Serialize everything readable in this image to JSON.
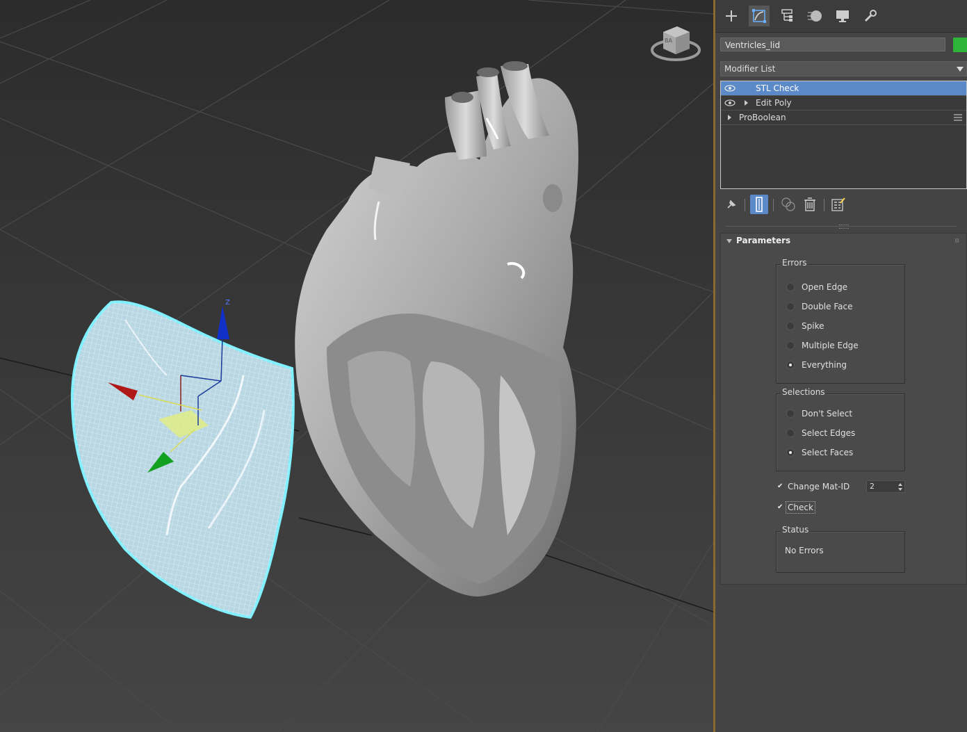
{
  "viewport": {
    "viewcube_label": "BA",
    "gizmo_axis_label": "Z"
  },
  "command_panel": {
    "tabs": [
      {
        "name": "create-tab",
        "icon": "plus-icon"
      },
      {
        "name": "modify-tab",
        "icon": "modify-icon"
      },
      {
        "name": "hierarchy-tab",
        "icon": "hierarchy-icon"
      },
      {
        "name": "motion-tab",
        "icon": "motion-icon"
      },
      {
        "name": "display-tab",
        "icon": "display-icon"
      },
      {
        "name": "utilities-tab",
        "icon": "wrench-icon"
      }
    ],
    "object_name": "Ventricles_lid",
    "object_color": "#2fb43a",
    "modifier_list_label": "Modifier List",
    "stack": [
      {
        "label": "STL Check",
        "selected": true
      },
      {
        "label": "Edit Poly",
        "selected": false
      },
      {
        "label": "ProBoolean",
        "selected": false
      }
    ],
    "parameters": {
      "title": "Parameters",
      "errors": {
        "title": "Errors",
        "options": [
          "Open Edge",
          "Double Face",
          "Spike",
          "Multiple Edge",
          "Everything"
        ],
        "selected": "Everything"
      },
      "selections": {
        "title": "Selections",
        "options": [
          "Don't Select",
          "Select Edges",
          "Select Faces"
        ],
        "selected": "Select Faces"
      },
      "change_mat_id": {
        "label": "Change Mat-ID",
        "checked": true,
        "value": "2"
      },
      "check": {
        "label": "Check",
        "checked": true
      },
      "status": {
        "title": "Status",
        "text": "No Errors"
      }
    }
  }
}
